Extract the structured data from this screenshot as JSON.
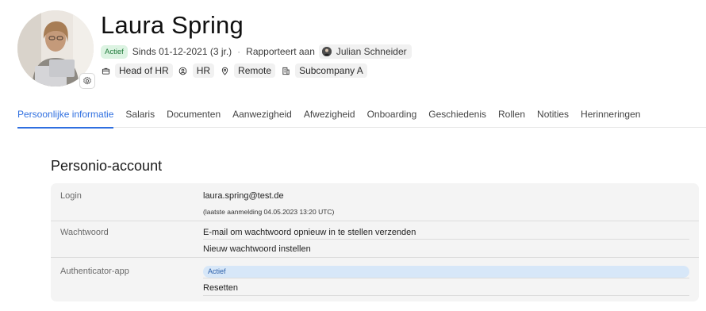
{
  "profile": {
    "name": "Laura Spring",
    "status_badge": "Actief",
    "since": "Sinds 01-12-2021 (3 jr.)",
    "separator": "·",
    "reports_to_label": "Rapporteert aan",
    "manager_name": "Julian Schneider"
  },
  "tags": {
    "position": "Head of HR",
    "department": "HR",
    "office": "Remote",
    "company": "Subcompany A"
  },
  "tabs": [
    {
      "label": "Persoonlijke informatie",
      "active": true
    },
    {
      "label": "Salaris"
    },
    {
      "label": "Documenten"
    },
    {
      "label": "Aanwezigheid"
    },
    {
      "label": "Afwezigheid"
    },
    {
      "label": "Onboarding"
    },
    {
      "label": "Geschiedenis"
    },
    {
      "label": "Rollen"
    },
    {
      "label": "Notities"
    },
    {
      "label": "Herinneringen"
    }
  ],
  "section": {
    "title": "Personio-account",
    "login_label": "Login",
    "login_email": "laura.spring@test.de",
    "last_login": "(laatste aanmelding 04.05.2023 13:20 UTC)",
    "password_label": "Wachtwoord",
    "reset_email_action": "E-mail om wachtwoord opnieuw in te stellen verzenden",
    "new_password_action": "Nieuw wachtwoord instellen",
    "authenticator_label": "Authenticator-app",
    "authenticator_status": "Actief",
    "reset_action": "Resetten"
  },
  "colors": {
    "accent": "#2f6fe0",
    "active_green_bg": "#dcf3e2",
    "active_blue_bg": "#d7e7f8",
    "card_bg": "#f4f4f4"
  },
  "icons": [
    "settings-gear-icon",
    "briefcase-icon",
    "person-circle-icon",
    "location-pin-icon",
    "building-icon"
  ]
}
